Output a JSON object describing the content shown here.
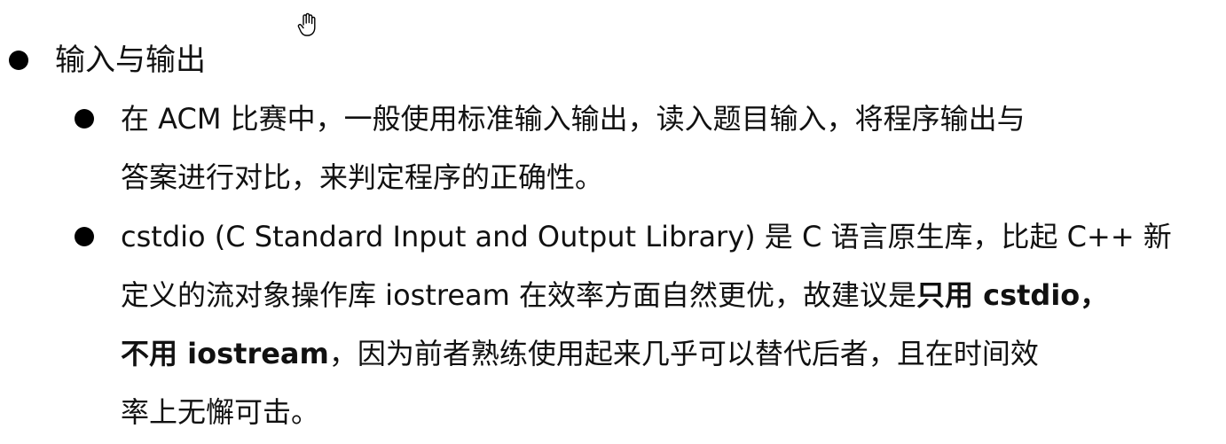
{
  "heading": "输入与输出",
  "items": [
    {
      "lines": [
        [
          "在 ACM 比赛中，一般使用标准输入输出，读入题目输入，将程序输出与"
        ],
        [
          "答案进行对比，来判定程序的正确性。"
        ]
      ]
    },
    {
      "line1": "cstdio (C Standard Input and Output Library) 是 C 语言原生库，比起 C++ 新",
      "line2_a": "定义的流对象操作库 iostream 在效率方面自然更优，故建议是",
      "line2_b": "只用 cstdio，",
      "line3_a": "不用  iostream",
      "line3_b": "，因为前者熟练使用起来几乎可以替代后者，且在时间效",
      "line4": "率上无懈可击。"
    }
  ]
}
